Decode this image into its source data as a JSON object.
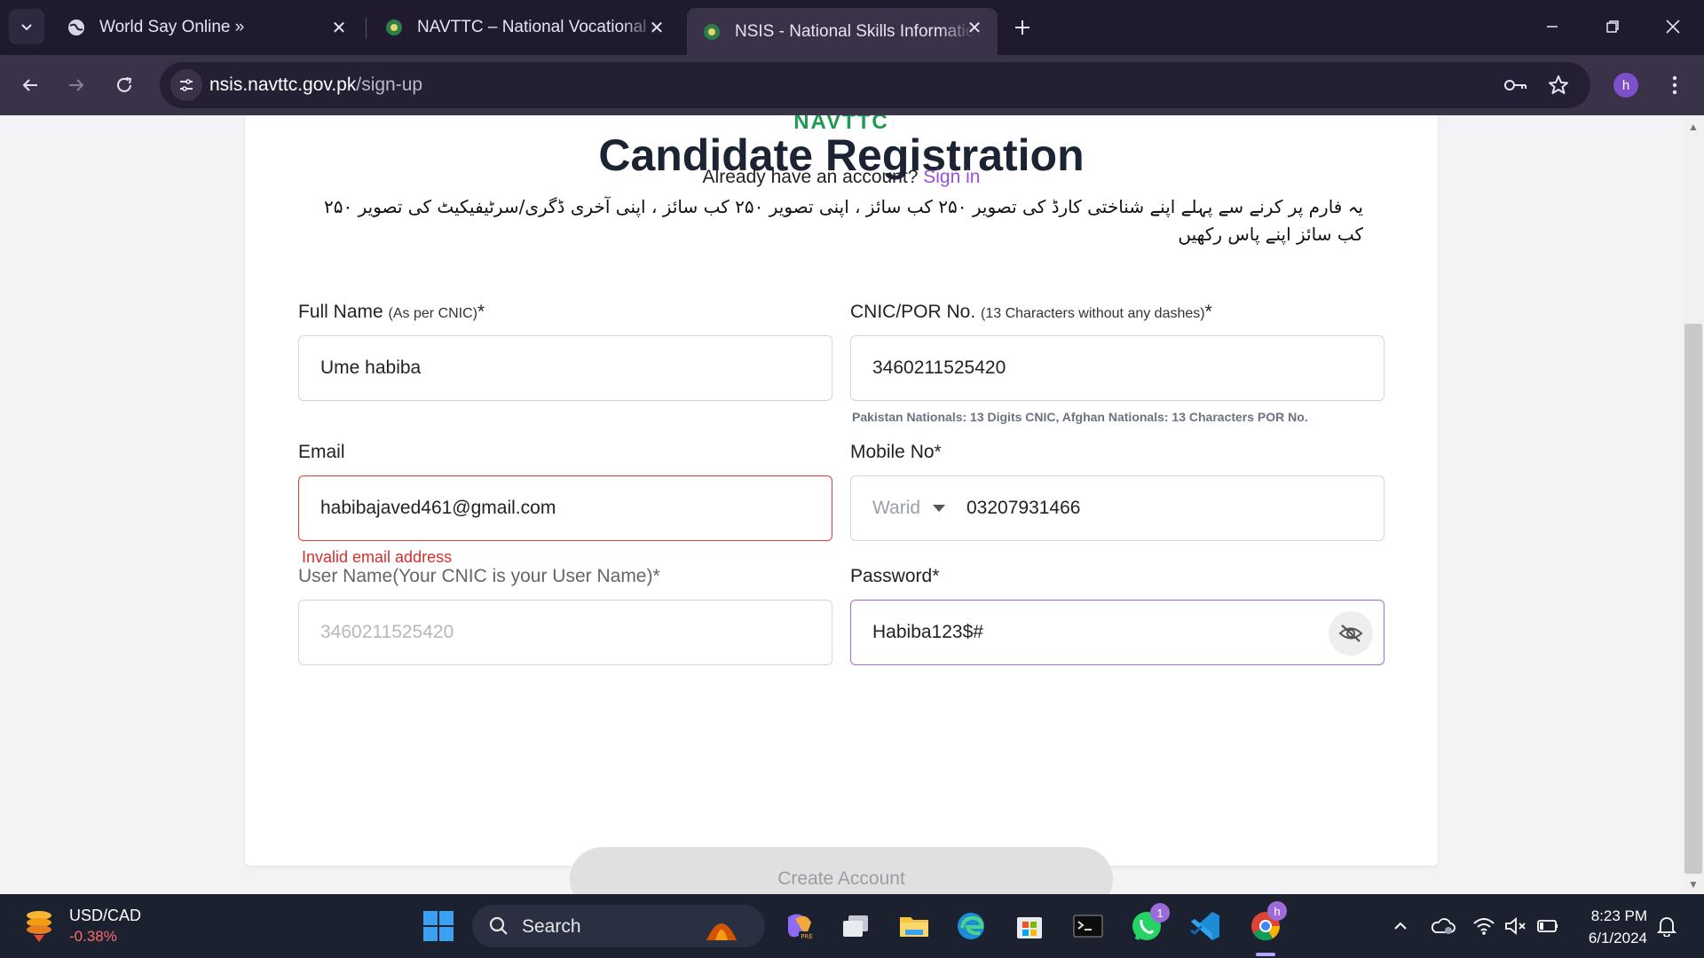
{
  "browser": {
    "tabs": [
      {
        "title": "World Say Online »",
        "active": false
      },
      {
        "title": "NAVTTC – National Vocational & Technical Training Commission",
        "active": false
      },
      {
        "title": "NSIS - National Skills Information System",
        "active": true
      }
    ],
    "url_host": "nsis.navttc.gov.pk",
    "url_path": "/sign-up",
    "profile_initial": "h"
  },
  "page": {
    "brand": "NAVTTC",
    "heading": "Candidate Registration",
    "signin_prompt": "Already have an account?",
    "signin_link": "Sign in",
    "urdu_notice": "یہ فارم پر کرنے سے پہلے اپنے شناختی کارڈ کی تصویر ۲۵۰ کب سائز ، اپنی تصویر ۲۵۰ کب سائز ، اپنی آخری ڈگری/سرٹیفیکیٹ کی تصویر ۲۵۰ کب سائز اپنے پاس رکھیں",
    "form": {
      "full_name": {
        "label": "Full Name",
        "note": "(As per CNIC)",
        "required": "*",
        "value": "Ume habiba"
      },
      "cnic": {
        "label": "CNIC/POR No.",
        "note": "(13 Characters without any dashes)",
        "required": "*",
        "value": "3460211525420",
        "hint": "Pakistan Nationals: 13 Digits CNIC, Afghan Nationals: 13 Characters POR No."
      },
      "email": {
        "label": "Email",
        "value": "habibajaved461@gmail.com",
        "error": "Invalid email address"
      },
      "mobile": {
        "label": "Mobile No",
        "required": "*",
        "carrier": "Warid",
        "value": "03207931466"
      },
      "username": {
        "label": "User Name(Your CNIC is your User Name)",
        "required": "*",
        "value": "3460211525420"
      },
      "password": {
        "label": "Password",
        "required": "*",
        "value": "Habiba123$#"
      },
      "submit_label": "Create Account"
    }
  },
  "taskbar": {
    "ticker_name": "USD/CAD",
    "ticker_change": "-0.38%",
    "search_label": "Search",
    "whatsapp_badge": "1",
    "chrome_badge": "h",
    "time": "8:23 PM",
    "date": "6/1/2024"
  },
  "colors": {
    "accent": "#9b4fe0",
    "brand_green": "#1f9a55",
    "error": "#d32f2f",
    "chrome_dark": "#1f1a2e"
  }
}
